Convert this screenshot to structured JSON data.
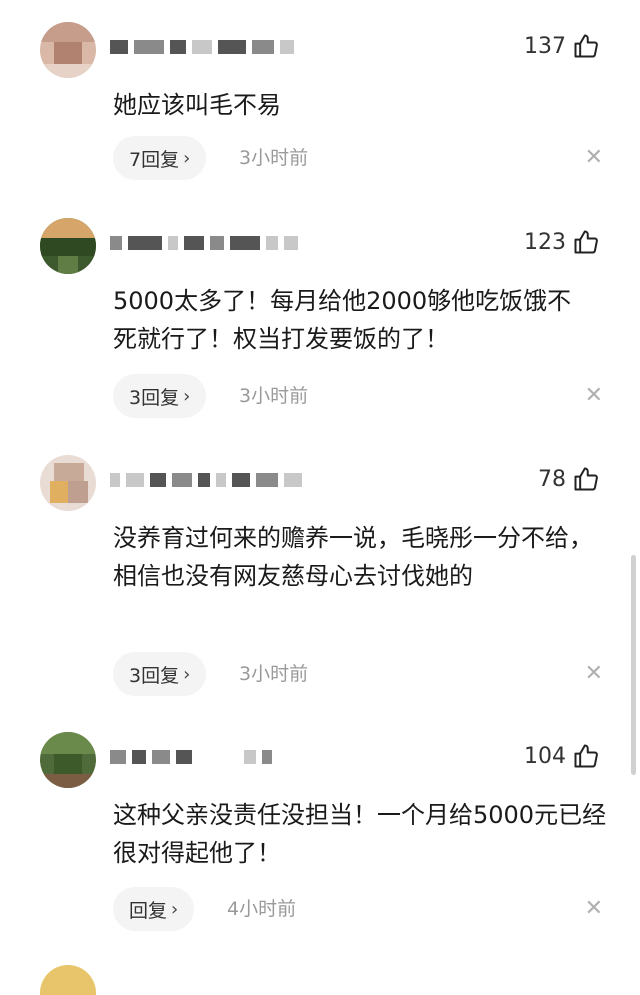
{
  "comments": [
    {
      "likes": "137",
      "text": "她应该叫毛不易",
      "replies": "7回复",
      "time": "3小时前"
    },
    {
      "likes": "123",
      "text": "5000太多了！每月给他2000够他吃饭饿不死就行了！权当打发要饭的了！",
      "replies": "3回复",
      "time": "3小时前"
    },
    {
      "likes": "78",
      "text": "没养育过何来的赡养一说，毛晓彤一分不给，相信也没有网友慈母心去讨伐她的",
      "replies": "3回复",
      "time": "3小时前"
    },
    {
      "likes": "104",
      "text": "这种父亲没责任没担当！一个月给5000元已经很对得起他了！",
      "replies": "回复",
      "time": "4小时前"
    }
  ],
  "icons": {
    "like": "thumbs-up-icon",
    "chevron": "chevron-right-icon",
    "close": "close-icon"
  },
  "colors": {
    "text": "#1a1a1a",
    "muted": "#9a9a9a",
    "pill": "#f4f4f4"
  }
}
